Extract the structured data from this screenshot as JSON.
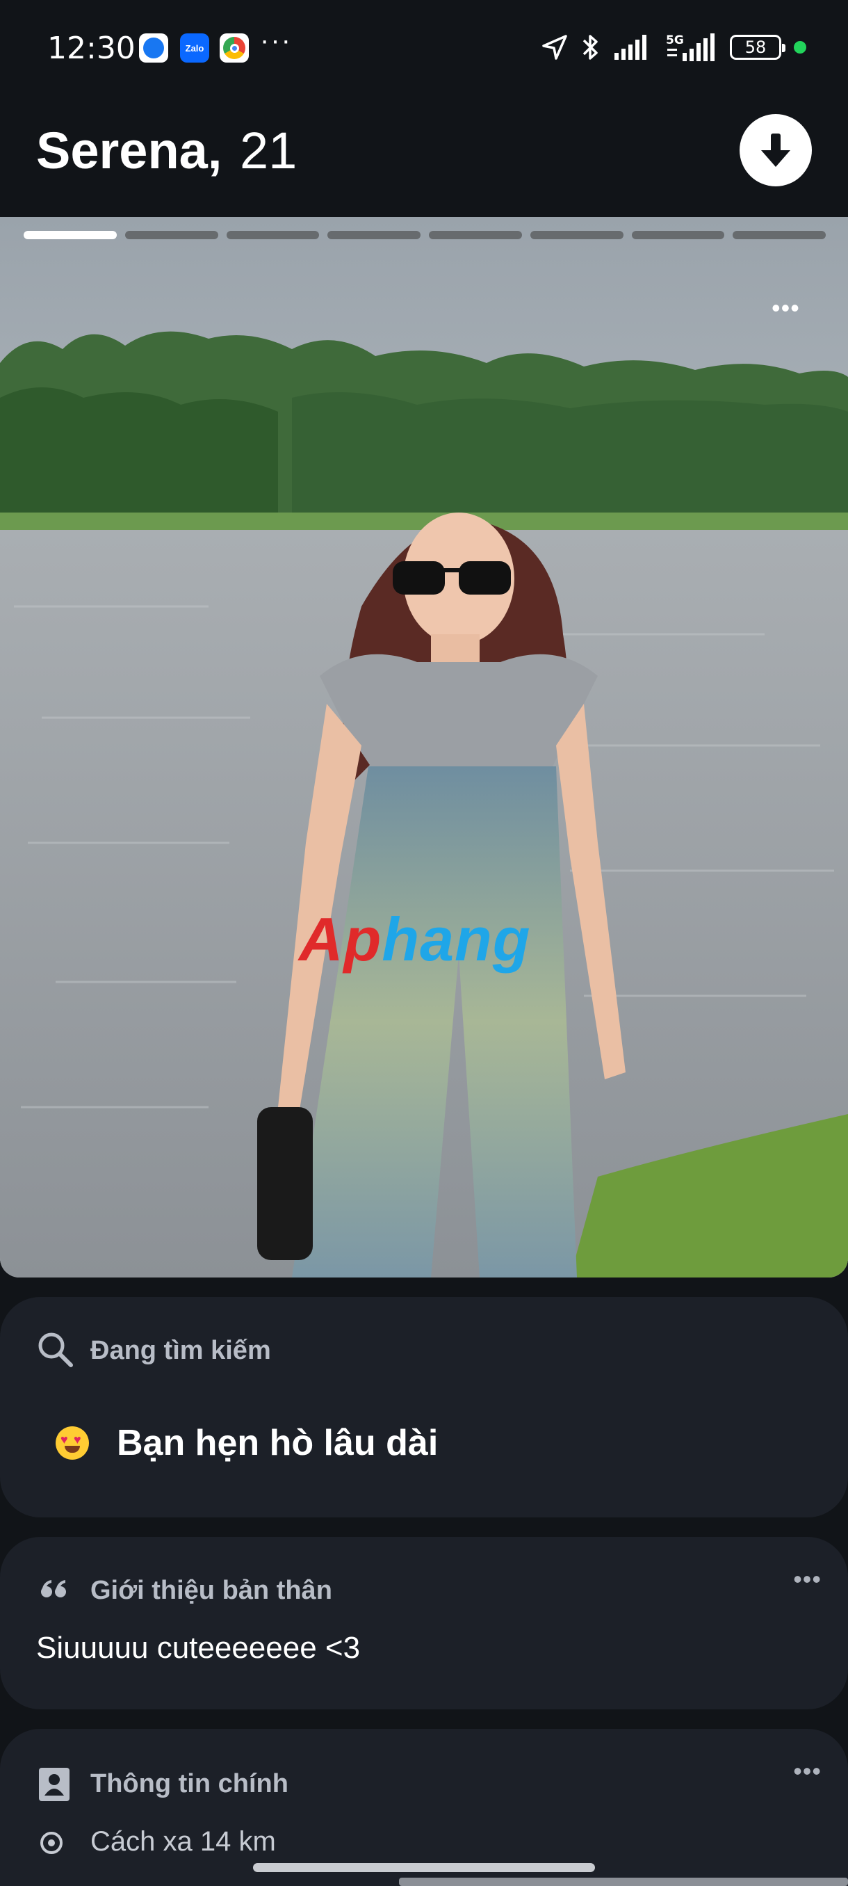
{
  "status_bar": {
    "time": "12:30",
    "battery": "58",
    "network": "5G",
    "apps": [
      "messenger-icon",
      "zalo-icon",
      "chrome-icon"
    ],
    "zalo_label": "Zalo"
  },
  "profile": {
    "name": "Serena,",
    "age": "21"
  },
  "photo": {
    "count": 8,
    "current": 1,
    "watermark_a": "Ap",
    "watermark_b": "hang"
  },
  "looking_for": {
    "title": "Đang tìm kiếm",
    "value": "Bạn hẹn hò lâu dài"
  },
  "bio": {
    "title": "Giới thiệu bản thân",
    "text": "Siuuuuu cuteeeeeee <3"
  },
  "basics": {
    "title": "Thông tin chính",
    "distance": "Cách xa 14 km"
  },
  "colors": {
    "background": "#111418",
    "card": "#1c2028",
    "online": "#22d45b"
  }
}
